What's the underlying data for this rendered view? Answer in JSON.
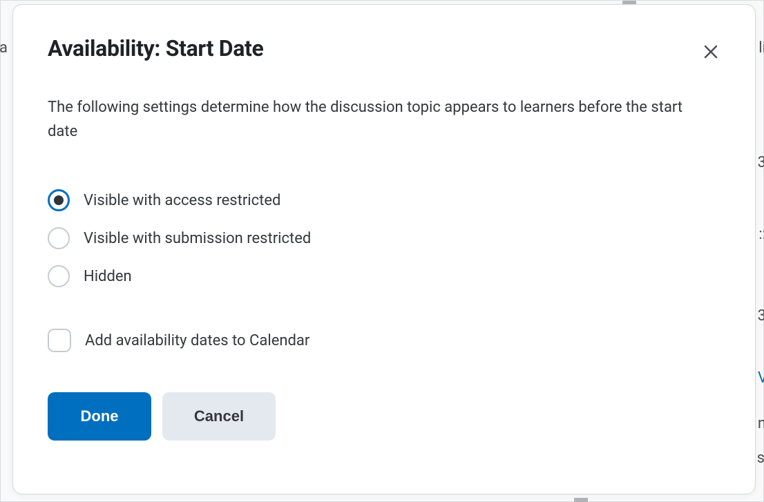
{
  "dialog": {
    "title": "Availability: Start Date",
    "description": "The following settings determine how the discussion topic appears to learners before the start date"
  },
  "radios": {
    "option1": {
      "label": "Visible with access restricted",
      "selected": true
    },
    "option2": {
      "label": "Visible with submission restricted",
      "selected": false
    },
    "option3": {
      "label": "Hidden",
      "selected": false
    }
  },
  "checkbox": {
    "label": "Add availability dates to Calendar",
    "checked": false
  },
  "buttons": {
    "done": "Done",
    "cancel": "Cancel"
  },
  "backdrop_fragments": {
    "left_a": "a",
    "right_li": "li",
    "right_3a": "3",
    "right_colon": "::",
    "right_3b": "3",
    "right_v": "V",
    "right_n": "n",
    "right_s": "s"
  }
}
